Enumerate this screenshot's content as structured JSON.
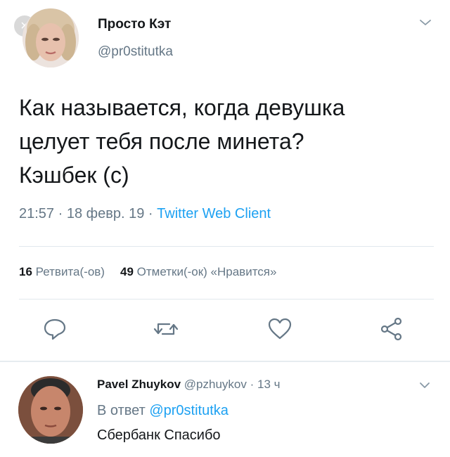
{
  "overlay": {
    "close_glyph": "×"
  },
  "tweet": {
    "display_name": "Просто Кэт",
    "handle": "@pr0stitutka",
    "text": "Как называется, когда девушка\nцелует тебя после минета?\nКэшбек (с)",
    "meta": {
      "time": "21:57",
      "date": "18 февр. 19",
      "separator": "·",
      "client": "Twitter Web Client"
    },
    "stats": {
      "retweets_count": "16",
      "retweets_label": "Ретвита(-ов)",
      "likes_count": "49",
      "likes_label": "Отметки(-ок) «Нравится»"
    },
    "actions": [
      "reply-icon",
      "retweet-icon",
      "like-icon",
      "share-icon"
    ]
  },
  "reply": {
    "display_name": "Pavel Zhuykov",
    "handle": "@pzhuykov",
    "separator": "·",
    "time": "13 ч",
    "reply_to_label": "В ответ",
    "reply_to_handle": "@pr0stitutka",
    "text": "Сбербанк Спасибо"
  },
  "colors": {
    "link": "#1da1f2",
    "secondary_text": "#657786",
    "primary_text": "#14171a",
    "divider": "#e1e8ed"
  }
}
